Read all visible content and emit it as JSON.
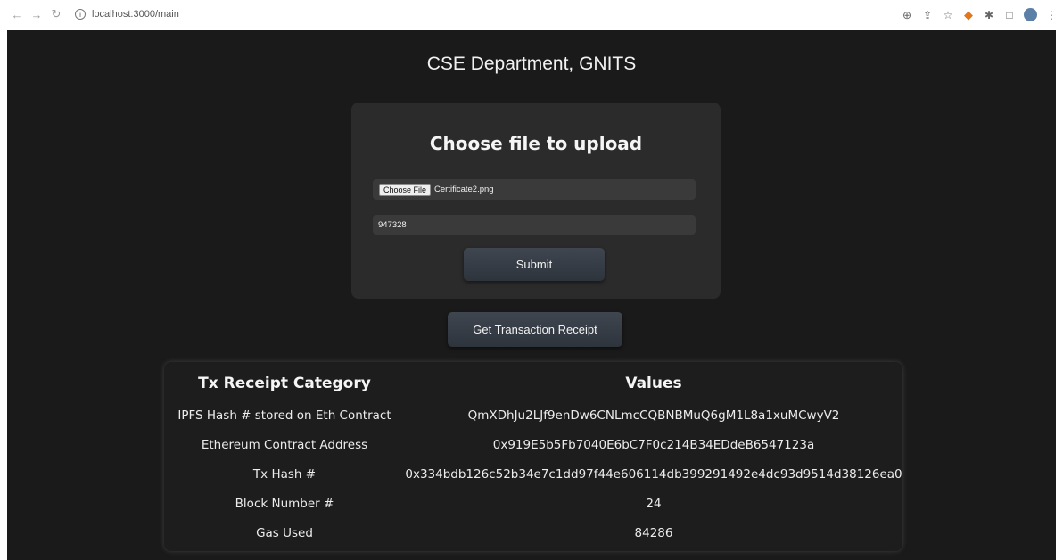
{
  "browser": {
    "url": "localhost:3000/main"
  },
  "page": {
    "title": "CSE Department, GNITS"
  },
  "upload": {
    "heading": "Choose file to upload",
    "file_button_label": "Choose File",
    "file_name": "Certificate2.png",
    "number_value": "947328",
    "submit_label": "Submit"
  },
  "receipt_button_label": "Get Transaction Receipt",
  "receipt": {
    "header_category": "Tx Receipt Category",
    "header_values": "Values",
    "rows": [
      {
        "category": "IPFS Hash # stored on Eth Contract",
        "value": "QmXDhJu2LJf9enDw6CNLmcCQBNBMuQ6gM1L8a1xuMCwyV2"
      },
      {
        "category": "Ethereum Contract Address",
        "value": "0x919E5b5Fb7040E6bC7F0c214B34EDdeB6547123a"
      },
      {
        "category": "Tx Hash #",
        "value": "0x334bdb126c52b34e7c1dd97f44e606114db399291492e4dc93d9514d38126ea0"
      },
      {
        "category": "Block Number #",
        "value": "24"
      },
      {
        "category": "Gas Used",
        "value": "84286"
      }
    ]
  }
}
